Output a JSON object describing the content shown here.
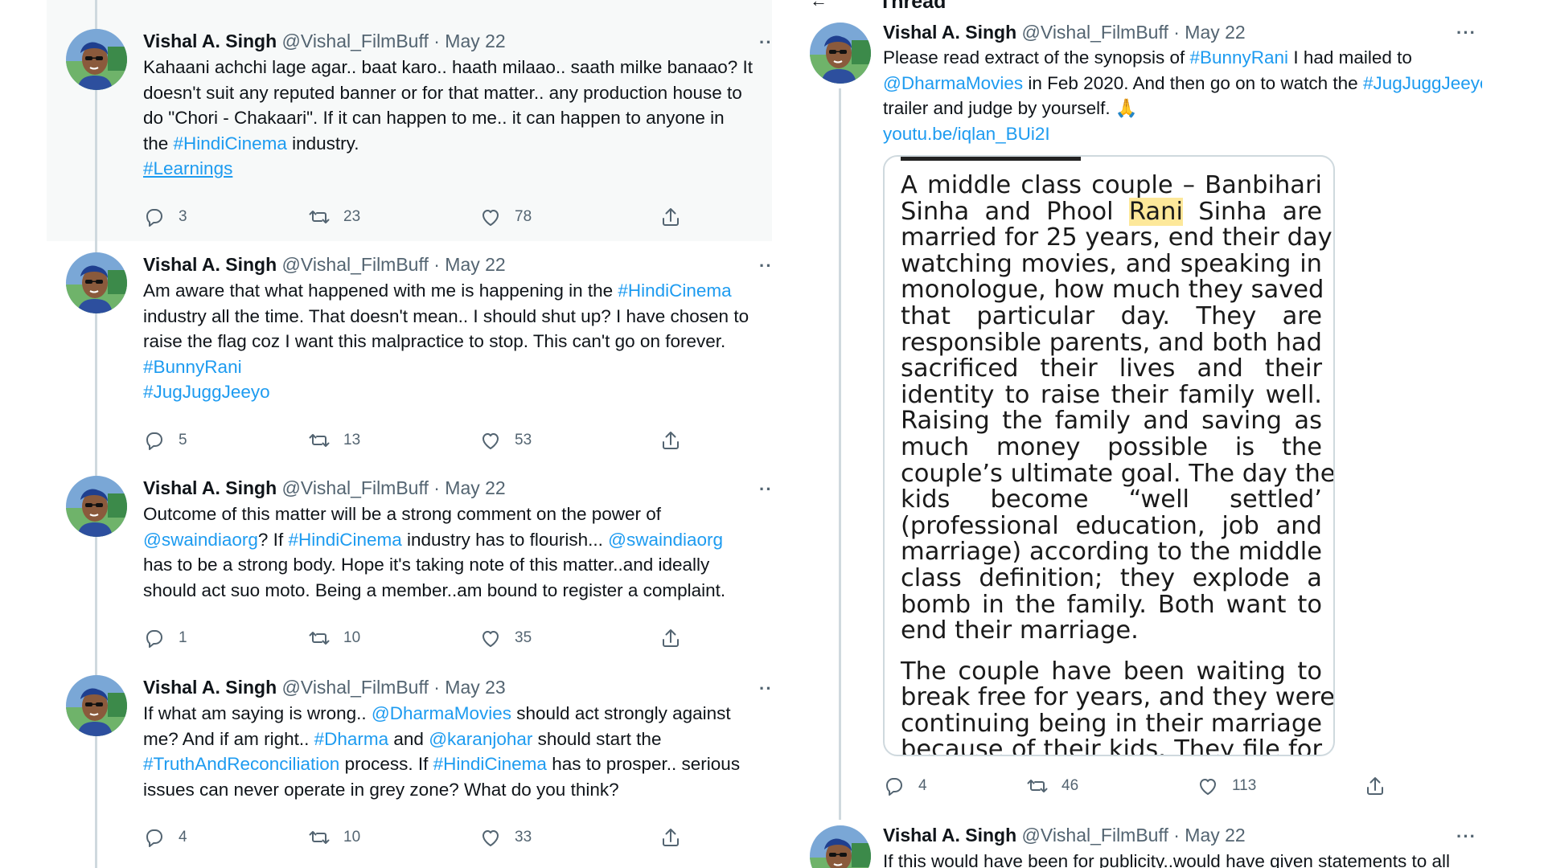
{
  "author": {
    "name": "Vishal A. Singh",
    "handle": "@Vishal_FilmBuff",
    "dot": "·"
  },
  "left_tweets": [
    {
      "date": "May 22",
      "more": "···",
      "lines": [
        [
          {
            "t": "Kahaani achchi lage agar.. baat karo.. haath milaao.. saath milke banaao? It"
          }
        ],
        [
          {
            "t": "doesn't suit any reputed banner or for that matter.. any production house to"
          }
        ],
        [
          {
            "t": "do \"Chori - Chakaari\". If it can happen to me.. it can happen to anyone in"
          }
        ],
        [
          {
            "t": "the "
          },
          {
            "t": "#HindiCinema",
            "link": true
          },
          {
            "t": " industry."
          }
        ],
        [
          {
            "t": "#Learnings",
            "link": true,
            "ul": true
          }
        ]
      ],
      "replies": "3",
      "retweets": "23",
      "likes": "78"
    },
    {
      "date": "May 22",
      "more": "···",
      "lines": [
        [
          {
            "t": "Am aware that what happened with me is happening in the "
          },
          {
            "t": "#HindiCinema",
            "link": true
          }
        ],
        [
          {
            "t": "industry all the time. That doesn't mean.. I should shut up? I have chosen to"
          }
        ],
        [
          {
            "t": "raise the flag coz I want this malpractice to stop. This can't go on forever."
          }
        ],
        [
          {
            "t": "#BunnyRani",
            "link": true
          }
        ],
        [
          {
            "t": "#JugJuggJeeyo",
            "link": true
          }
        ]
      ],
      "replies": "5",
      "retweets": "13",
      "likes": "53"
    },
    {
      "date": "May 22",
      "more": "···",
      "lines": [
        [
          {
            "t": "Outcome of this matter will be a strong comment on the power of"
          }
        ],
        [
          {
            "t": "@swaindiaorg",
            "link": true
          },
          {
            "t": "? If "
          },
          {
            "t": "#HindiCinema",
            "link": true
          },
          {
            "t": " industry has to flourish... "
          },
          {
            "t": "@swaindiaorg",
            "link": true
          }
        ],
        [
          {
            "t": "has to be a strong body. Hope it's taking note of this matter..and ideally"
          }
        ],
        [
          {
            "t": "should act suo moto. Being a member..am bound to register a complaint."
          }
        ]
      ],
      "replies": "1",
      "retweets": "10",
      "likes": "35"
    },
    {
      "date": "May 23",
      "more": "···",
      "lines": [
        [
          {
            "t": "If what am saying is wrong.. "
          },
          {
            "t": "@DharmaMovies",
            "link": true
          },
          {
            "t": " should act strongly against"
          }
        ],
        [
          {
            "t": "me? And if am right.. "
          },
          {
            "t": "#Dharma",
            "link": true
          },
          {
            "t": " and "
          },
          {
            "t": "@karanjohar",
            "link": true
          },
          {
            "t": " should start the"
          }
        ],
        [
          {
            "t": "#TruthAndReconciliation",
            "link": true
          },
          {
            "t": " process. If "
          },
          {
            "t": "#HindiCinema",
            "link": true
          },
          {
            "t": " has to prosper.. serious"
          }
        ],
        [
          {
            "t": "issues can never operate in grey zone? What do you think?"
          }
        ]
      ],
      "replies": "4",
      "retweets": "10",
      "likes": "33"
    }
  ],
  "right_panel": {
    "title": "Thread",
    "back_arrow": "←",
    "main_tweet": {
      "date": "May 22",
      "more": "···",
      "lines": [
        [
          {
            "t": "Please read extract of the synopsis of "
          },
          {
            "t": "#BunnyRani",
            "link": true
          },
          {
            "t": " I had mailed to"
          }
        ],
        [
          {
            "t": "@DharmaMovies",
            "link": true
          },
          {
            "t": " in Feb 2020. And then go on to watch the "
          },
          {
            "t": "#JugJuggJeeyo",
            "link": true
          }
        ],
        [
          {
            "t": "trailer and judge by yourself. 🙏"
          }
        ],
        [
          {
            "t": "youtu.be/iqlan_BUi2I",
            "link": true
          }
        ]
      ],
      "replies": "4",
      "retweets": "46",
      "likes": "113"
    },
    "document_lines": [
      [
        {
          "t": "A middle class couple – Banbihari"
        }
      ],
      [
        {
          "t": "Sinha and Phool "
        },
        {
          "t": "Rani",
          "hl": true
        },
        {
          "t": " Sinha are"
        }
      ],
      [
        {
          "t": "married for 25 years, end their day"
        }
      ],
      [
        {
          "t": "watching movies, and speaking in"
        }
      ],
      [
        {
          "t": "monologue, how much they saved"
        }
      ],
      [
        {
          "t": "that particular day. They are"
        }
      ],
      [
        {
          "t": "responsible parents, and both had"
        }
      ],
      [
        {
          "t": "sacrificed their lives and their"
        }
      ],
      [
        {
          "t": "identity to raise their family well."
        }
      ],
      [
        {
          "t": "Raising the family and saving as"
        }
      ],
      [
        {
          "t": "much money possible is the"
        }
      ],
      [
        {
          "t": "couple’s ultimate goal. The day the"
        }
      ],
      [
        {
          "t": "kids become “well settled’"
        }
      ],
      [
        {
          "t": "(professional education, job and"
        }
      ],
      [
        {
          "t": "marriage) according to the middle"
        }
      ],
      [
        {
          "t": "class definition; they explode a"
        }
      ],
      [
        {
          "t": "bomb in the family. Both want to"
        }
      ],
      [
        {
          "t": "end their marriage."
        }
      ]
    ],
    "document_lines_2": [
      [
        {
          "t": "The couple have been waiting to"
        }
      ],
      [
        {
          "t": "break free for years, and they were"
        }
      ],
      [
        {
          "t": "continuing being in their marriage"
        }
      ],
      [
        {
          "t": "because of their kids. They file for"
        }
      ]
    ],
    "next_tweet": {
      "date": "May 22",
      "more": "···",
      "text": "If this would have been for publicity..would have given statements to all"
    }
  },
  "icons": [
    "reply-icon",
    "retweet-icon",
    "like-icon",
    "share-icon",
    "avatar-photo"
  ],
  "colors": {
    "link": "#1d9bf0",
    "muted": "#536471",
    "text": "#0f1419",
    "highlight": "#fde89a"
  }
}
